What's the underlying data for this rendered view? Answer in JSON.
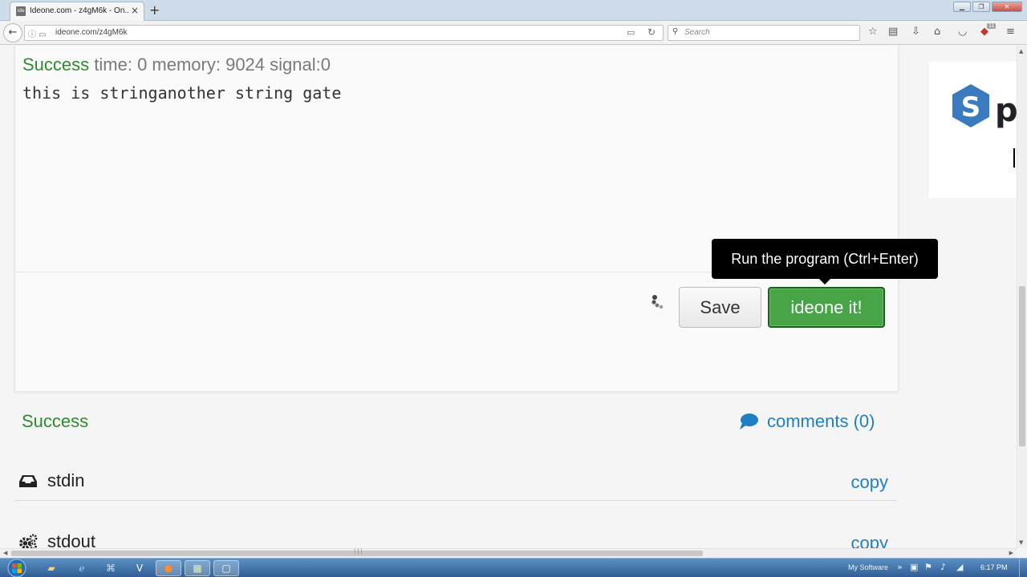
{
  "browser": {
    "tab_title": "Ideone.com - z4gM6k - On...",
    "tab_favicon_text": "ide",
    "tab_close_symbol": "×",
    "new_tab_symbol": "+",
    "url": "ideone.com/z4gM6k",
    "search_placeholder": "Search",
    "notification_count": "11"
  },
  "result": {
    "status": "Success",
    "meta": "time: 0 memory: 9024 signal:0",
    "output": "this is stringanother string gate"
  },
  "actions": {
    "save_label": "Save",
    "run_label": "ideone it!",
    "tooltip": "Run the program (Ctrl+Enter)"
  },
  "sidebar_ad": {
    "letter": "p"
  },
  "summary": {
    "status": "Success",
    "comments_label": "comments (0)"
  },
  "io": [
    {
      "label": "stdin",
      "copy": "copy",
      "icon": "inbox-icon"
    },
    {
      "label": "stdout",
      "copy": "copy",
      "icon": "gears-icon"
    }
  ],
  "taskbar": {
    "tray_label": "My Software",
    "clock": "6:17 PM"
  },
  "colors": {
    "success_green": "#2f8a2f",
    "run_button_green": "#47a447",
    "link_blue": "#1f7fc2",
    "tooltip_bg": "#000000"
  }
}
